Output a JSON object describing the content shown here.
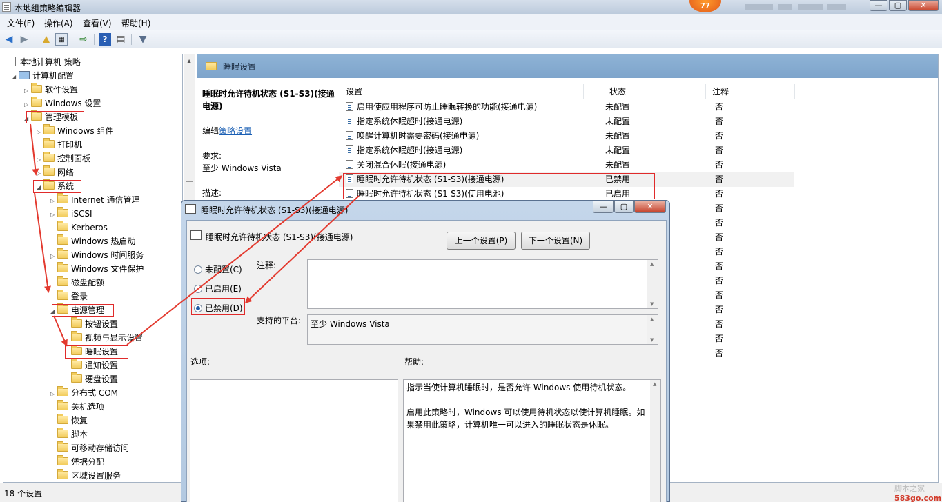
{
  "window": {
    "title": "本地组策略编辑器",
    "badge": "77",
    "buttons": {
      "minimize": "—",
      "maximize": "▢",
      "close": "✕"
    }
  },
  "menu": [
    "文件(F)",
    "操作(A)",
    "查看(V)",
    "帮助(H)"
  ],
  "toolbar": {
    "icons": [
      "back-icon",
      "forward-icon",
      "up-folder-icon",
      "show-hide-tree-icon",
      "export-list-icon",
      "help-icon",
      "properties-icon",
      "filter-icon"
    ]
  },
  "tree": {
    "items": [
      {
        "label": "本地计算机 策略"
      },
      {
        "label": "计算机配置"
      },
      {
        "label": "软件设置"
      },
      {
        "label": "Windows 设置"
      },
      {
        "label": "管理模板"
      },
      {
        "label": "Windows 组件"
      },
      {
        "label": "打印机"
      },
      {
        "label": "控制面板"
      },
      {
        "label": "网络"
      },
      {
        "label": "系统"
      },
      {
        "label": "Internet 通信管理"
      },
      {
        "label": "iSCSI"
      },
      {
        "label": "Kerberos"
      },
      {
        "label": "Windows 热启动"
      },
      {
        "label": "Windows 时间服务"
      },
      {
        "label": "Windows 文件保护"
      },
      {
        "label": "磁盘配额"
      },
      {
        "label": "登录"
      },
      {
        "label": "电源管理"
      },
      {
        "label": "按钮设置"
      },
      {
        "label": "视频与显示设置"
      },
      {
        "label": "睡眠设置"
      },
      {
        "label": "通知设置"
      },
      {
        "label": "硬盘设置"
      },
      {
        "label": "分布式 COM"
      },
      {
        "label": "关机选项"
      },
      {
        "label": "恢复"
      },
      {
        "label": "脚本"
      },
      {
        "label": "可移动存储访问"
      },
      {
        "label": "凭据分配"
      },
      {
        "label": "区域设置服务"
      }
    ]
  },
  "right_pane": {
    "header": "睡眠设置",
    "desc": {
      "title": "睡眠时允许待机状态 (S1-S3)(接通电源)",
      "edit_prefix": "编辑",
      "edit_link": "策略设置",
      "req_label": "要求:",
      "req_value": "至少 Windows Vista",
      "desc_label": "描述:"
    },
    "columns": {
      "setting": "设置",
      "state": "状态",
      "note": "注释"
    },
    "rows": [
      {
        "name": "启用使应用程序可防止睡眠转换的功能(接通电源)",
        "state": "未配置",
        "note": "否"
      },
      {
        "name": "指定系统休眠超时(接通电源)",
        "state": "未配置",
        "note": "否"
      },
      {
        "name": "唤醒计算机时需要密码(接通电源)",
        "state": "未配置",
        "note": "否"
      },
      {
        "name": "指定系统休眠超时(接通电源)",
        "state": "未配置",
        "note": "否"
      },
      {
        "name": "关闭混合休眠(接通电源)",
        "state": "未配置",
        "note": "否"
      },
      {
        "name": "睡眠时允许待机状态 (S1-S3)(接通电源)",
        "state": "已禁用",
        "note": "否"
      },
      {
        "name": "睡眠时允许待机状态 (S1-S3)(使用电池)",
        "state": "已启用",
        "note": "否"
      },
      {
        "name": "",
        "state": "",
        "note": "否"
      },
      {
        "name": "",
        "state": "",
        "note": "否"
      },
      {
        "name": "",
        "state": "",
        "note": "否"
      },
      {
        "name": "",
        "state": "",
        "note": "否"
      },
      {
        "name": "",
        "state": "",
        "note": "否"
      },
      {
        "name": "",
        "state": "",
        "note": "否"
      },
      {
        "name": "",
        "state": "",
        "note": "否"
      },
      {
        "name": "",
        "state": "",
        "note": "否"
      },
      {
        "name": "",
        "state": "",
        "note": "否"
      },
      {
        "name": "",
        "state": "",
        "note": "否"
      },
      {
        "name": "",
        "state": "",
        "note": "否"
      }
    ]
  },
  "status": {
    "text": "18 个设置"
  },
  "watermark": {
    "brand": "脚本之家",
    "url": "583go.com"
  },
  "dialog": {
    "title": "睡眠时允许待机状态 (S1-S3)(接通电源)",
    "heading": "睡眠时允许待机状态 (S1-S3)(接通电源)",
    "prev_btn": "上一个设置(P)",
    "next_btn": "下一个设置(N)",
    "radios": [
      {
        "label": "未配置(C)",
        "checked": false
      },
      {
        "label": "已启用(E)",
        "checked": false
      },
      {
        "label": "已禁用(D)",
        "checked": true
      }
    ],
    "comment_label": "注释:",
    "platform_label": "支持的平台:",
    "platform_value": "至少 Windows Vista",
    "options_label": "选项:",
    "help_label": "帮助:",
    "help_paragraphs": [
      "指示当使计算机睡眠时，是否允许 Windows 使用待机状态。",
      "启用此策略时，Windows 可以使用待机状态以使计算机睡眠。如果禁用此策略，计算机唯一可以进入的睡眠状态是休眠。"
    ]
  },
  "colors": {
    "accent": "#7ea4cb",
    "highlight_box": "#e02b2b",
    "arrow": "#e33a2f"
  }
}
